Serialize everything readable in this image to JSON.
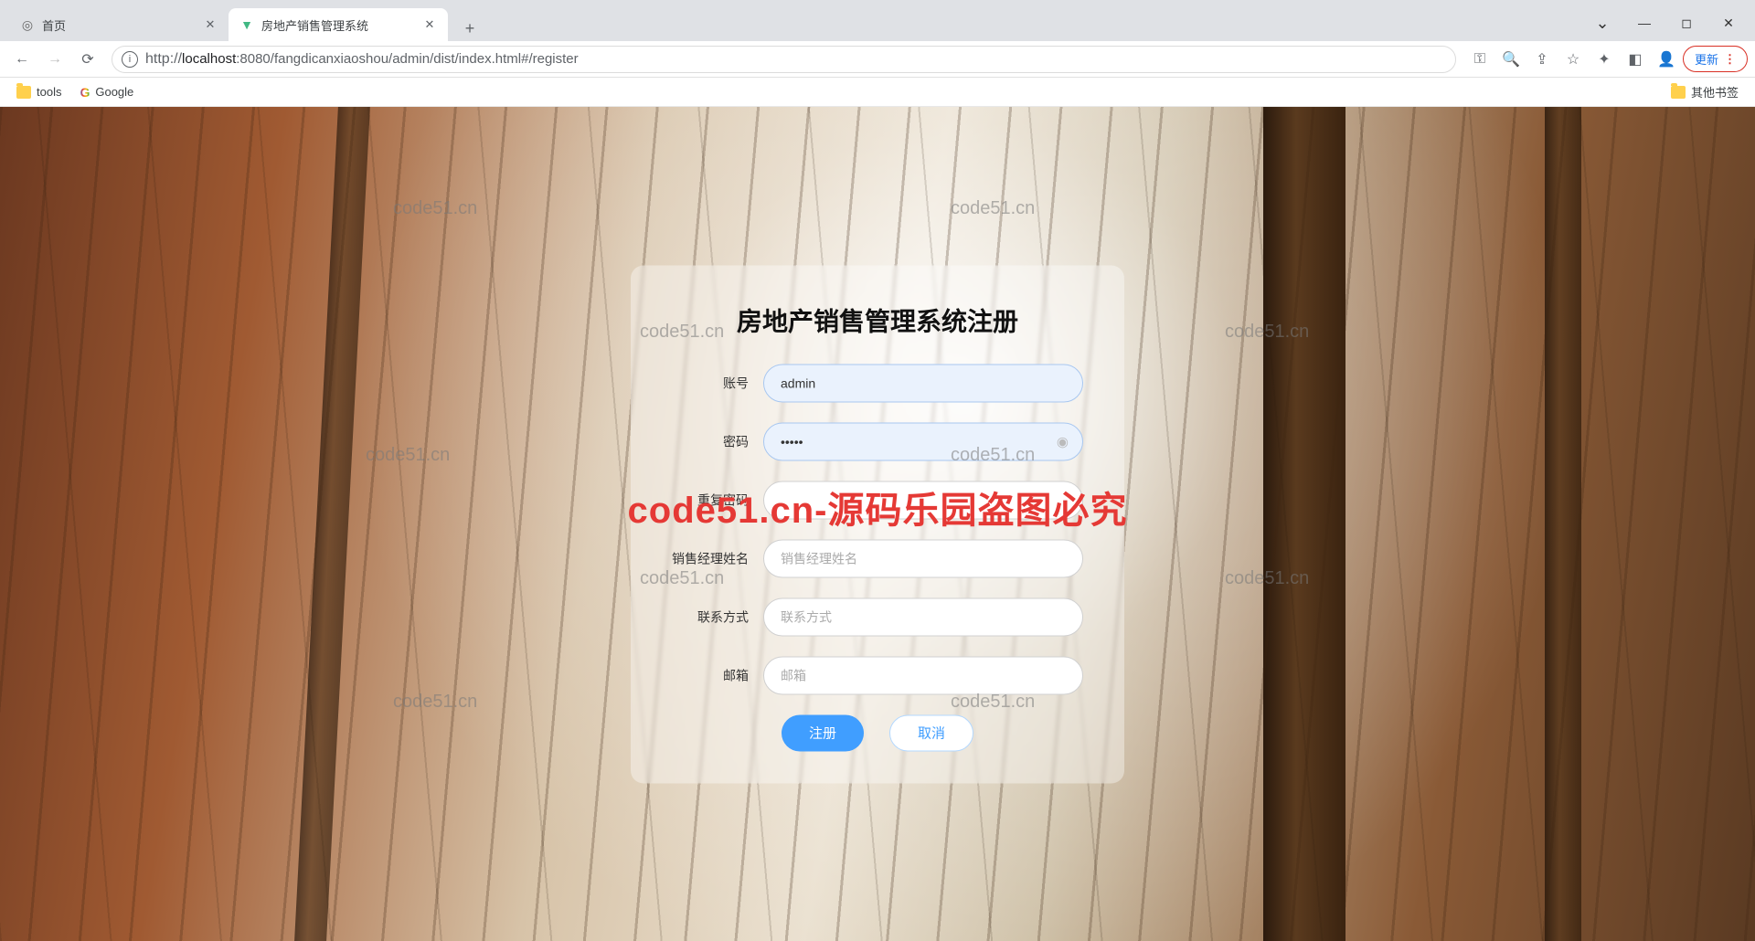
{
  "browser": {
    "tabs": [
      {
        "title": "首页",
        "favicon": "globe"
      },
      {
        "title": "房地产销售管理系统",
        "favicon": "vue"
      }
    ],
    "active_tab_index": 1,
    "url_host": "localhost",
    "url_port": "8080",
    "url_path": "/fangdicanxiaoshou/admin/dist/index.html#/register",
    "window_controls": {
      "dropdown": "⌄",
      "minimize": "—",
      "maximize": "◻",
      "close": "✕"
    },
    "update_label": "更新"
  },
  "bookmarks": {
    "items": [
      {
        "label": "tools",
        "icon": "folder"
      },
      {
        "label": "Google",
        "icon": "g"
      }
    ],
    "right": {
      "label": "其他书签",
      "icon": "folder"
    }
  },
  "form": {
    "title": "房地产销售管理系统注册",
    "fields": {
      "username": {
        "label": "账号",
        "value": "admin",
        "placeholder": ""
      },
      "password": {
        "label": "密码",
        "value": "•••••",
        "placeholder": ""
      },
      "repeat": {
        "label": "重复密码",
        "value": "",
        "placeholder": ""
      },
      "manager": {
        "label": "销售经理姓名",
        "value": "",
        "placeholder": "销售经理姓名"
      },
      "contact": {
        "label": "联系方式",
        "value": "",
        "placeholder": "联系方式"
      },
      "email": {
        "label": "邮箱",
        "value": "",
        "placeholder": "邮箱"
      }
    },
    "buttons": {
      "submit": "注册",
      "cancel": "取消"
    }
  },
  "watermark": {
    "main": "code51.cn-源码乐园盗图必究",
    "small": "code51.cn"
  }
}
